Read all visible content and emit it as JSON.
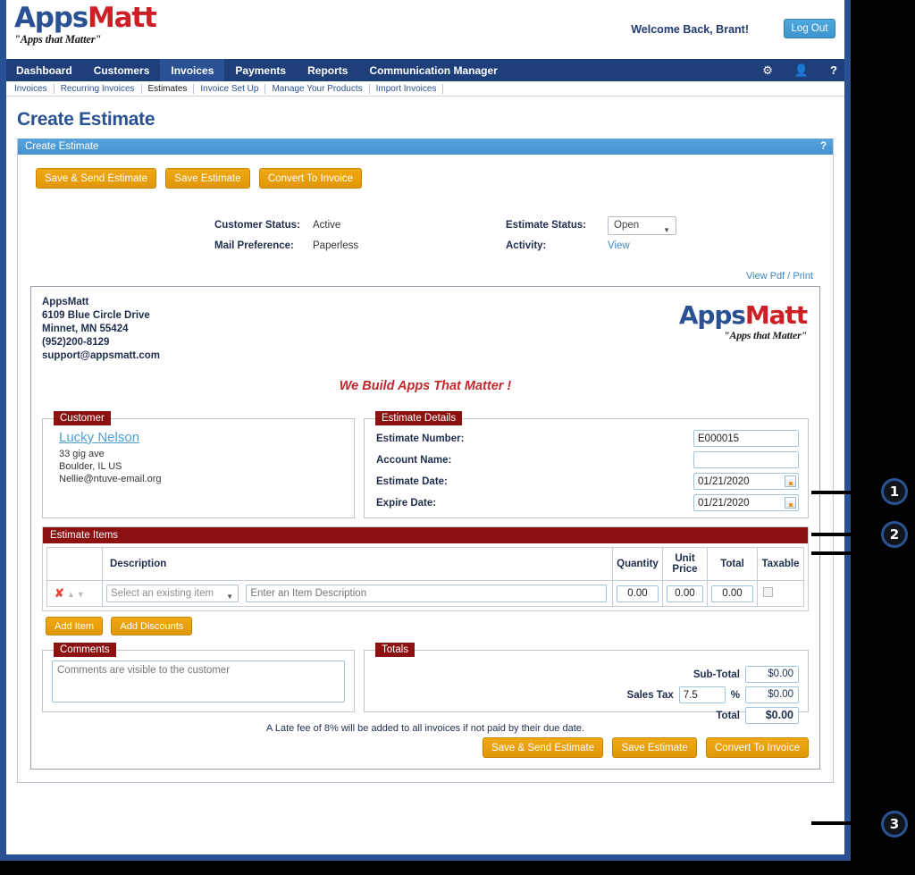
{
  "header": {
    "logo_primary": "Apps",
    "logo_secondary": "Matt",
    "logo_tagline": "\"Apps that Matter\"",
    "welcome": "Welcome Back, Brant!",
    "logout_label": "Log Out",
    "icons": {
      "settings": "gear-icon",
      "user": "user-icon",
      "help": "help-icon"
    }
  },
  "mainnav": {
    "items": [
      {
        "label": "Dashboard",
        "active": false
      },
      {
        "label": "Customers",
        "active": false
      },
      {
        "label": "Invoices",
        "active": true
      },
      {
        "label": "Payments",
        "active": false
      },
      {
        "label": "Reports",
        "active": false
      },
      {
        "label": "Communication Manager",
        "active": false
      }
    ]
  },
  "subnav": {
    "items": [
      {
        "label": "Invoices"
      },
      {
        "label": "Recurring Invoices"
      },
      {
        "label": "Estimates"
      },
      {
        "label": "Invoice Set Up"
      },
      {
        "label": "Manage Your Products"
      },
      {
        "label": "Import Invoices"
      }
    ]
  },
  "page": {
    "title": "Create Estimate",
    "panel_title": "Create Estimate",
    "panel_help": "?"
  },
  "toolbar": {
    "save_send_label": "Save & Send Estimate",
    "save_label": "Save Estimate",
    "convert_label": "Convert To Invoice"
  },
  "status": {
    "customer_status_label": "Customer Status:",
    "customer_status_value": "Active",
    "mail_preference_label": "Mail Preference:",
    "mail_preference_value": "Paperless",
    "estimate_status_label": "Estimate Status:",
    "estimate_status_value": "Open",
    "activity_label": "Activity:",
    "activity_value": "View"
  },
  "viewpdf": {
    "label": "View Pdf / Print"
  },
  "document": {
    "company": {
      "name": "AppsMatt",
      "address1": "6109 Blue Circle Drive",
      "address2": "Minnet, MN 55424",
      "phone": "(952)200-8129",
      "email": "support@appsmatt.com"
    },
    "tagline": "We Build Apps That Matter !",
    "logo_primary": "Apps",
    "logo_secondary": "Matt",
    "logo_tagline": "\"Apps that Matter\""
  },
  "customer": {
    "legend": "Customer",
    "name": "Lucky Nelson",
    "address": "33 gig ave",
    "city_state": "Boulder, IL US",
    "email": "Nellie@ntuve-email.org"
  },
  "estimate_details": {
    "legend": "Estimate Details",
    "estimate_number_label": "Estimate Number:",
    "estimate_number_value": "E000015",
    "account_name_label": "Account Name:",
    "account_name_value": "",
    "estimate_date_label": "Estimate Date:",
    "estimate_date_value": "01/21/2020",
    "expire_date_label": "Expire Date:",
    "expire_date_value": "01/21/2020"
  },
  "estimate_items": {
    "title": "Estimate Items",
    "columns": [
      "",
      "Description",
      "Quantity",
      "Unit Price",
      "Total",
      "Taxable"
    ],
    "rows": [
      {
        "delete_icon": "delete-x-icon",
        "move_up_icon": "arrow-up-icon",
        "move_down_icon": "arrow-down-icon",
        "item_select": "Select an existing item",
        "description_placeholder": "Enter an Item Description",
        "description_value": "",
        "quantity": "0.00",
        "unit_price": "0.00",
        "total": "0.00",
        "taxable": false
      }
    ],
    "add_item_label": "Add Item",
    "add_discounts_label": "Add Discounts"
  },
  "comments": {
    "legend": "Comments",
    "placeholder": "Comments are visible to the customer",
    "value": ""
  },
  "totals": {
    "legend": "Totals",
    "sub_total_label": "Sub-Total",
    "sub_total_value": "$0.00",
    "sales_tax_label": "Sales Tax",
    "sales_tax_rate": "7.5",
    "percent_symbol": "%",
    "sales_tax_value": "$0.00",
    "total_label": "Total",
    "total_value": "$0.00"
  },
  "footer": {
    "late_fee_note": "A Late fee of 8% will be added to all invoices if not paid by their due date.",
    "save_send_label": "Save & Send Estimate",
    "save_label": "Save Estimate",
    "convert_label": "Convert To Invoice"
  },
  "callouts": [
    {
      "number": "1"
    },
    {
      "number": "2"
    },
    {
      "number": "3"
    }
  ],
  "colors": {
    "nav_blue": "#1f3f7a",
    "nav_active": "#2a5193",
    "panel_blue": "#4392cf",
    "legend_red": "#8c1111",
    "button_orange": "#e09708",
    "accent_red": "#c0282d",
    "link_blue": "#3b86c9"
  }
}
